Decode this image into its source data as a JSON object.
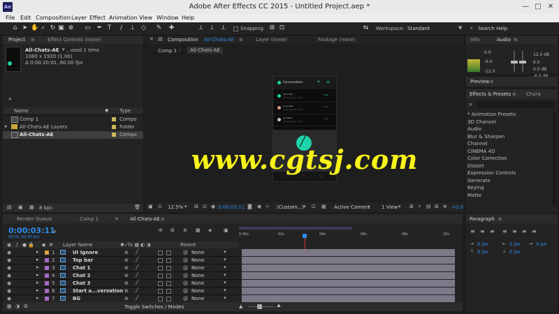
{
  "app": {
    "logo": "Ae",
    "title": "Adobe After Effects CC 2015 - Untitled Project.aep *",
    "window_buttons": [
      "—",
      "□",
      "✕"
    ]
  },
  "menu": [
    "File",
    "Edit",
    "Composition",
    "Layer",
    "Effect",
    "Animation",
    "View",
    "Window",
    "Help"
  ],
  "toolbar": {
    "snapping_label": "Snapping",
    "workspace_label": "Workspace:",
    "workspace_value": "Standard",
    "search_help_placeholder": "Search Help"
  },
  "project_panel": {
    "tab": "Project",
    "effect_controls_tab": "Effect Controls (none)",
    "selected_name": "All-Chats-AE",
    "used": ", used 1 time",
    "dims": "1080 x 1920 (1.00)",
    "duration": "Δ 0:00:20:01, 60.00 fps",
    "search_placeholder": "",
    "col_name": "Name",
    "col_type": "Type",
    "items": [
      {
        "name": "Comp 1",
        "type": "Compo"
      },
      {
        "name": "All-Chats-AE Layers",
        "type": "Folder"
      },
      {
        "name": "All-Chats-AE",
        "type": "Compo"
      }
    ],
    "bpc": "8 bpc"
  },
  "composition_panel": {
    "tab_prefix": "Composition",
    "tab_name": "All-Chats-AE",
    "layer_tab": "Layer (none)",
    "footage_tab": "Footage (none)",
    "breadcrumbs": [
      "Comp 1",
      "All-Chats-AE"
    ],
    "zoom": "12.5%",
    "timecode": "0:00:03:11",
    "resolution": "(Custom...)",
    "camera": "Active Camera",
    "view": "1 View",
    "plus": "+0.0"
  },
  "phone_preview": {
    "header": "Conversations",
    "rows": [
      {
        "name": "Sam Holt",
        "line": "Lorem ipsum dolor",
        "time": "9:00"
      },
      {
        "name": "Aura Keel",
        "line": "Lorem ipsum dolor",
        "time": "8:15"
      },
      {
        "name": "Jon Ward",
        "line": "Lorem ipsum dolor",
        "time": "7:40"
      }
    ],
    "accent": "#1ed3a8"
  },
  "watermark": "www.cgtsj.com",
  "info_panel": {
    "info_tab": "Info",
    "audio_tab": "Audio",
    "db_right": [
      "12.0 dB",
      "6.0",
      "0.0 dB",
      "-6.0 dB"
    ],
    "db_left": [
      "0.0",
      "-6.0",
      "-12.0"
    ]
  },
  "preview_panel": {
    "tab": "Preview"
  },
  "effects_panel": {
    "tab": "Effects & Presets",
    "char_tab": "Chara",
    "search_placeholder": "",
    "items": [
      "* Animation Presets",
      "3D Channel",
      "Audio",
      "Blur & Sharpen",
      "Channel",
      "CINEMA 4D",
      "Color Correction",
      "Distort",
      "Expression Controls",
      "Generate",
      "Keying",
      "Matte"
    ]
  },
  "timeline": {
    "tabs": [
      "Render Queue",
      "Comp 1",
      "All-Chats-AE"
    ],
    "timecode": "0:00:03:11",
    "frames": "00191 (60.00 fps)",
    "search_placeholder": "",
    "col_layer_name": "Layer Name",
    "col_parent": "Parent",
    "ruler": [
      "0:00s",
      "02s",
      "04s",
      "06s",
      "08s",
      "10s"
    ],
    "layers": [
      {
        "num": "1",
        "name": "UI Ignore",
        "parent": "None"
      },
      {
        "num": "2",
        "name": "Top bar",
        "parent": "None"
      },
      {
        "num": "3",
        "name": "Chat 1",
        "parent": "None"
      },
      {
        "num": "4",
        "name": "Chat 2",
        "parent": "None"
      },
      {
        "num": "5",
        "name": "Chat 3",
        "parent": "None"
      },
      {
        "num": "6",
        "name": "Start a...versation",
        "parent": "None"
      },
      {
        "num": "7",
        "name": "BG",
        "parent": "None"
      }
    ],
    "footer_toggle": "Toggle Switches / Modes",
    "playhead_seconds": 3.18
  },
  "paragraph_panel": {
    "tab": "Paragraph",
    "fields": [
      "0 px",
      "0 px",
      "0 px",
      "0 px",
      "0 px"
    ]
  },
  "colors": {
    "accent_blue": "#2d8ceb",
    "playhead": "#e0342f",
    "layer_bar": "#7d7988",
    "watermark": "#f7f21a"
  }
}
